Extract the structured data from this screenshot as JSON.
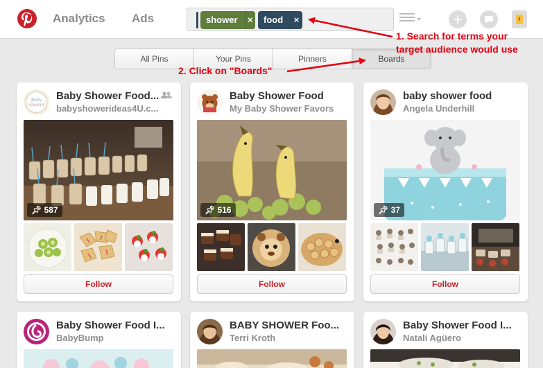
{
  "header": {
    "nav": {
      "analytics": "Analytics",
      "ads": "Ads"
    },
    "search": {
      "chips": [
        {
          "label": "shower",
          "remove": "×",
          "color": "#5f7d3c"
        },
        {
          "label": "food",
          "remove": "×",
          "color": "#2e4b5f"
        }
      ]
    },
    "icons": [
      "pinterest-logo",
      "grid-view-icon",
      "plus-icon",
      "chat-icon",
      "notification-icon"
    ]
  },
  "tabs": [
    {
      "label": "All Pins",
      "active": false
    },
    {
      "label": "Your Pins",
      "active": false
    },
    {
      "label": "Pinners",
      "active": false
    },
    {
      "label": "Boards",
      "active": true
    }
  ],
  "annotations": {
    "step1_line1": "1. Search for terms your",
    "step1_line2": "target audience would use",
    "step2": "2. Click on \"Boards\"",
    "color": "#e3000f"
  },
  "boards": [
    {
      "title": "Baby Shower Food...",
      "owner": "babyshowerideas4U.c...",
      "pins": "587",
      "follow": "Follow",
      "collaborative": true
    },
    {
      "title": "Baby Shower Food",
      "owner": "My Baby Shower Favors",
      "pins": "516",
      "follow": "Follow",
      "collaborative": false
    },
    {
      "title": "baby shower food",
      "owner": "Angela Underhill",
      "pins": "37",
      "follow": "Follow",
      "collaborative": false
    },
    {
      "title": "Baby Shower Food I...",
      "owner": "BabyBump"
    },
    {
      "title": "BABY SHOWER Foo...",
      "owner": "Terri Kroth"
    },
    {
      "title": "Baby Shower Food I...",
      "owner": "Natali Agüero"
    }
  ],
  "colors": {
    "brand": "#cb2027",
    "background": "#e9e9e9"
  }
}
